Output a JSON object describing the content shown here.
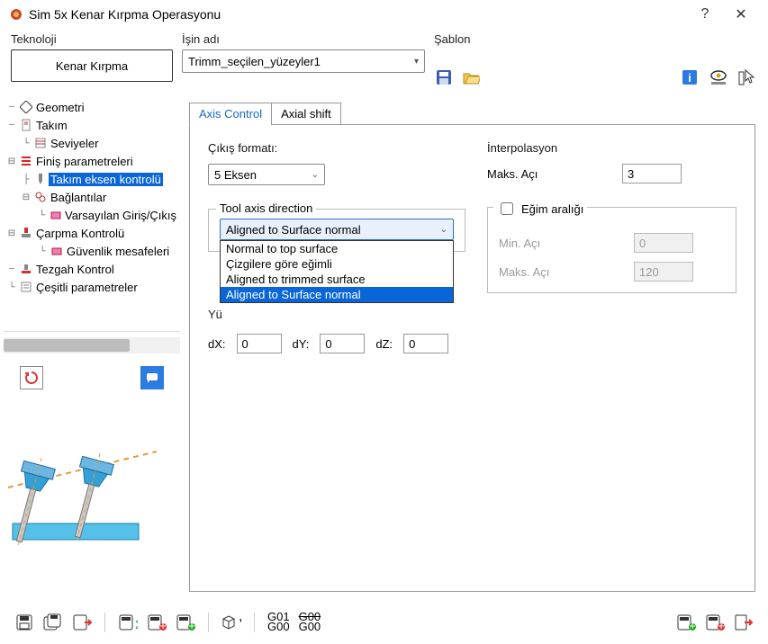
{
  "window": {
    "title": "Sim 5x Kenar Kırpma Operasyonu"
  },
  "top": {
    "tech_label": "Teknoloji",
    "tech_button": "Kenar Kırpma",
    "job_label": "İşin adı",
    "job_value": "Trimm_seçilen_yüzeyler1",
    "template_label": "Şablon"
  },
  "tree": {
    "items": [
      {
        "label": "Geometri"
      },
      {
        "label": "Takım"
      },
      {
        "label": "Seviyeler"
      },
      {
        "label": "Finiş parametreleri"
      },
      {
        "label": "Takım eksen kontrolü"
      },
      {
        "label": "Bağlantılar"
      },
      {
        "label": "Varsayılan Giriş/Çıkış"
      },
      {
        "label": "Çarpma Kontrolü"
      },
      {
        "label": "Güvenlik mesafeleri"
      },
      {
        "label": "Tezgah Kontrol"
      },
      {
        "label": "Çeşitli parametreler"
      }
    ]
  },
  "tabs": {
    "axis_control": "Axis Control",
    "axial_shift": "Axial shift"
  },
  "left_col": {
    "output_format_label": "Çıkış formatı:",
    "output_format_value": "5 Eksen",
    "tool_axis_group": "Tool axis direction",
    "tool_axis_value": "Aligned to Surface normal",
    "tool_axis_options": [
      "Normal to top surface",
      "Çizgilere göre eğimli",
      "Aligned to trimmed surface",
      "Aligned to Surface normal"
    ],
    "yu_label": "Yü",
    "dx_label": "dX:",
    "dx_value": "0",
    "dy_label": "dY:",
    "dy_value": "0",
    "dz_label": "dZ:",
    "dz_value": "0"
  },
  "right_col": {
    "interp_label": "İnterpolasyon",
    "max_angle_label": "Maks. Açı",
    "max_angle_value": "3",
    "tilt_group": "Eğim aralığı",
    "min_label": "Min. Açı",
    "min_value": "0",
    "max_label": "Maks. Açı",
    "max_value": "120"
  },
  "footer": {
    "g01": "G01",
    "g00a": "G00",
    "g00b": "G00",
    "g00c": "G00"
  }
}
